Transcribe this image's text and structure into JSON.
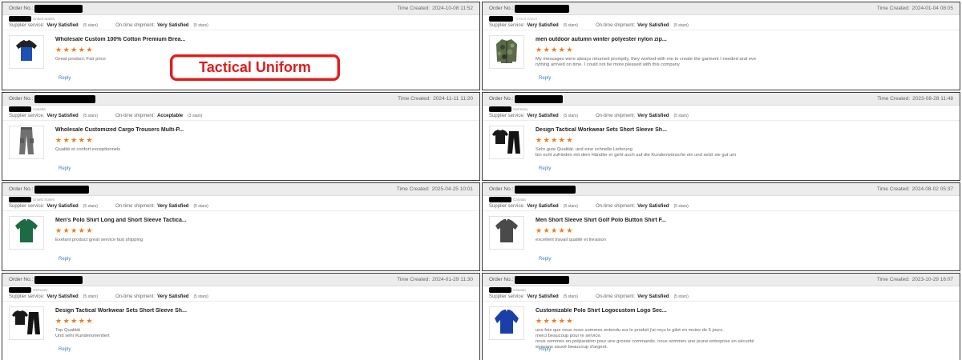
{
  "labels": {
    "order_no": "Order No.:",
    "time_created": "Time Created:",
    "supplier_service": "Supplier service:",
    "on_time_shipment": "On-time shipment:",
    "reply": "Reply"
  },
  "stamp": {
    "text": "Tactical Uniform",
    "color": "#e01b1b"
  },
  "colors": {
    "accent_star": "#f27a1a",
    "link": "#3a7bd5",
    "header_bg": "#ececec"
  },
  "reviews": [
    {
      "country": "United States",
      "time": "2024-10-08 11:52",
      "supplier_rating": "Very Satisfied",
      "supplier_stars": "(5 stars)",
      "shipment_rating": "Very Satisfied",
      "shipment_stars": "(5 stars)",
      "title": "Wholesale Custom 100% Cotton Premium Brea...",
      "stars": 5,
      "comment": "Great product. Fair price",
      "thumb": "tshirt-icon"
    },
    {
      "country": "",
      "time": "2024-01-04 08:05",
      "supplier_rating": "Very Satisfied",
      "supplier_stars": "(5 stars)",
      "shipment_rating": "Very Satisfied",
      "shipment_stars": "(5 stars)",
      "title": "men outdoor autumn winter polyester nylon zip...",
      "stars": 5,
      "comment": "My messages were always returned promptly, they worked with me to create the garment I needed and eve\nrything arrived on time. I could not be more pleased with this company",
      "thumb": "jacket-icon"
    },
    {
      "country": "Canada",
      "time": "2024-11-11 11:20",
      "supplier_rating": "Very Satisfied",
      "supplier_stars": "(5 stars)",
      "shipment_rating": "Acceptable",
      "shipment_stars": "(3 stars)",
      "title": "Wholesale Customized Cargo Trousers Multi-P...",
      "stars": 5,
      "comment": "Qualité et confort exceptionnels",
      "thumb": "trousers-icon"
    },
    {
      "country": "Germany",
      "time": "2023-08-28 11:48",
      "supplier_rating": "Very Satisfied",
      "supplier_stars": "(5 stars)",
      "shipment_rating": "Very Satisfied",
      "shipment_stars": "(5 stars)",
      "title": "Design Tactical Workwear Sets Short Sleeve Sh...",
      "stars": 5,
      "comment": "Sehr gute Qualität. und eine schnelle Lieferung\nbin echt zufrieden mit dem Händler er geht auch auf die Kundenwünsche ein und setzt sie gut um",
      "thumb": "workwear-set-icon"
    },
    {
      "country": "United States",
      "time": "2025-04-25 10:01",
      "supplier_rating": "Very Satisfied",
      "supplier_stars": "(5 stars)",
      "shipment_rating": "Very Satisfied",
      "shipment_stars": "(5 stars)",
      "title": "Men's Polo Shirt Long and Short Sleeve Tactica...",
      "stars": 5,
      "comment": "Exelant product great service fast shipping",
      "thumb": "polo-green-icon"
    },
    {
      "country": "Canada",
      "time": "2024-08-02 05:37",
      "supplier_rating": "Very Satisfied",
      "supplier_stars": "(5 stars)",
      "shipment_rating": "Very Satisfied",
      "shipment_stars": "(5 stars)",
      "title": "Men Short Sleeve Shirt Golf Polo Button Shirt F...",
      "stars": 5,
      "comment": "excellent travail qualité et livraison",
      "thumb": "polo-grey-icon"
    },
    {
      "country": "Germany",
      "time": "2024-01-29 11:30",
      "supplier_rating": "Very Satisfied",
      "supplier_stars": "(5 stars)",
      "shipment_rating": "Very Satisfied",
      "shipment_stars": "(5 stars)",
      "title": "Design Tactical Workwear Sets Short Sleeve Sh...",
      "stars": 5,
      "comment": "Top Qualität\nUnd sehr Kundenorientiert",
      "thumb": "workwear-set-icon"
    },
    {
      "country": "Canada",
      "time": "2023-10-29 16:07",
      "supplier_rating": "Very Satisfied",
      "supplier_stars": "(5 stars)",
      "shipment_rating": "Very Satisfied",
      "shipment_stars": "(5 stars)",
      "title": "Customizable Polo Shirt Logocustom Logo Sec...",
      "stars": 5,
      "comment": "une fois que nous nous sommes entendu sur le produit j'ai reçu le gilet en moins de 5 jours.\nmerci beaucoup pour le service.\nnous sommes en préparation pour une grosse commande. nous sommes une jeune entreprise en sécurité\net avons sauvé beaucoup d'argent.",
      "thumb": "polo-blue-icon"
    }
  ]
}
